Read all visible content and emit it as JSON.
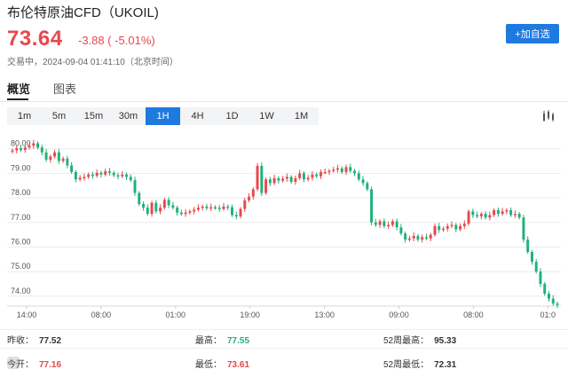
{
  "header": {
    "title": "布伦特原油CFD（UKOIL)",
    "price": "73.64",
    "change": "-3.88 ( -5.01%)",
    "status": "交易中，2024-09-04 01:41:10（北京时间）",
    "watch_label": "+加自选"
  },
  "tabs": [
    {
      "label": "概览",
      "active": true
    },
    {
      "label": "图表",
      "active": false
    }
  ],
  "intervals": [
    {
      "label": "1m",
      "active": false
    },
    {
      "label": "5m",
      "active": false
    },
    {
      "label": "15m",
      "active": false
    },
    {
      "label": "30m",
      "active": false
    },
    {
      "label": "1H",
      "active": true
    },
    {
      "label": "4H",
      "active": false
    },
    {
      "label": "1D",
      "active": false
    },
    {
      "label": "1W",
      "active": false
    },
    {
      "label": "1M",
      "active": false
    }
  ],
  "chart_data": {
    "type": "candlestick",
    "y_ticks": [
      "80.00",
      "79.00",
      "78.00",
      "77.00",
      "76.00",
      "75.00",
      "74.00"
    ],
    "x_ticks": [
      "14:00",
      "08:00",
      "01:00",
      "19:00",
      "13:00",
      "09:00",
      "08:00",
      "01:0"
    ],
    "ylim": [
      73.6,
      80.6
    ],
    "grid": true,
    "up_color": "#e8484c",
    "down_color": "#20b07a",
    "closes": [
      79.93,
      80.02,
      79.95,
      80.05,
      80.12,
      80.22,
      80.05,
      79.85,
      79.55,
      79.68,
      79.85,
      79.5,
      79.6,
      79.32,
      79.05,
      78.75,
      78.82,
      78.85,
      78.95,
      78.9,
      79.02,
      78.95,
      79.08,
      79.02,
      78.92,
      78.88,
      78.95,
      78.85,
      78.72,
      78.2,
      77.75,
      77.6,
      77.35,
      77.8,
      77.45,
      77.6,
      77.92,
      77.7,
      77.6,
      77.4,
      77.35,
      77.4,
      77.45,
      77.52,
      77.6,
      77.65,
      77.58,
      77.62,
      77.6,
      77.55,
      77.65,
      77.62,
      77.3,
      77.25,
      77.55,
      77.9,
      78.05,
      78.35,
      79.3,
      78.2,
      78.75,
      78.6,
      78.8,
      78.7,
      78.78,
      78.85,
      78.65,
      78.8,
      79.0,
      78.75,
      78.82,
      78.95,
      78.88,
      79.05,
      79.05,
      79.1,
      79.15,
      79.2,
      79.05,
      79.25,
      79.1,
      79.0,
      78.75,
      78.6,
      78.35,
      77.0,
      76.9,
      77.05,
      76.85,
      76.9,
      77.05,
      76.8,
      76.55,
      76.3,
      76.35,
      76.45,
      76.3,
      76.4,
      76.35,
      76.5,
      76.85,
      76.7,
      76.75,
      76.85,
      76.9,
      76.72,
      76.85,
      76.95,
      77.45,
      77.3,
      77.25,
      77.35,
      77.2,
      77.3,
      77.5,
      77.35,
      77.45,
      77.5,
      77.3,
      77.35,
      77.2,
      76.3,
      75.8,
      75.4,
      75.0,
      74.5,
      74.1,
      73.9,
      73.7,
      73.64
    ]
  },
  "stats": [
    {
      "label": "昨收：",
      "value": "77.52",
      "color": "neutral"
    },
    {
      "label": "最高：",
      "value": "77.55",
      "color": "down"
    },
    {
      "label": "52周最高：",
      "value": "95.33",
      "color": "neutral"
    },
    {
      "label": "今开：",
      "value": "77.16",
      "color": "up"
    },
    {
      "label": "最低：",
      "value": "73.61",
      "color": "up"
    },
    {
      "label": "52周最低：",
      "value": "72.31",
      "color": "neutral"
    }
  ],
  "watermark": "人民资讯"
}
